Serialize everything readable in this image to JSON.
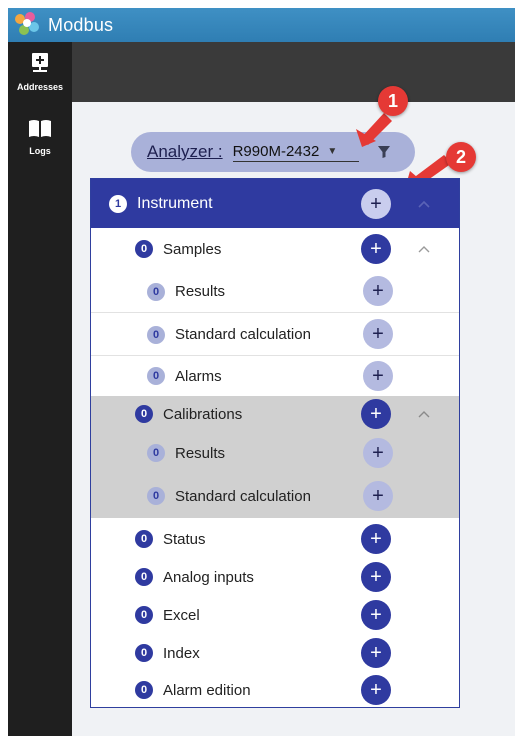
{
  "app": {
    "title": "Modbus"
  },
  "sidebar": {
    "items": [
      {
        "label": "Addresses",
        "icon": "network-plus-icon"
      },
      {
        "label": "Logs",
        "icon": "book-icon"
      }
    ]
  },
  "analyzer": {
    "label": "Analyzer :",
    "selected": "R990M-2432",
    "dropdown_icon": "caret-down-icon",
    "filter_icon": "filter-icon"
  },
  "annotations": [
    "1",
    "2"
  ],
  "tree": {
    "root": {
      "count": "1",
      "label": "Instrument"
    },
    "samples": {
      "count": "0",
      "label": "Samples",
      "children": [
        {
          "count": "0",
          "label": "Results"
        },
        {
          "count": "0",
          "label": "Standard calculation"
        },
        {
          "count": "0",
          "label": "Alarms"
        }
      ]
    },
    "calibrations": {
      "count": "0",
      "label": "Calibrations",
      "children": [
        {
          "count": "0",
          "label": "Results"
        },
        {
          "count": "0",
          "label": "Standard calculation"
        }
      ]
    },
    "others": [
      {
        "count": "0",
        "label": "Status"
      },
      {
        "count": "0",
        "label": "Analog inputs"
      },
      {
        "count": "0",
        "label": "Excel"
      },
      {
        "count": "0",
        "label": "Index"
      },
      {
        "count": "0",
        "label": "Alarm edition"
      }
    ]
  },
  "colors": {
    "primary": "#2f3aa0",
    "primary_light": "#a9b1d9",
    "annotation": "#e53935",
    "titlebar": "#3f90c4",
    "sidebar": "#1f1f1f"
  }
}
